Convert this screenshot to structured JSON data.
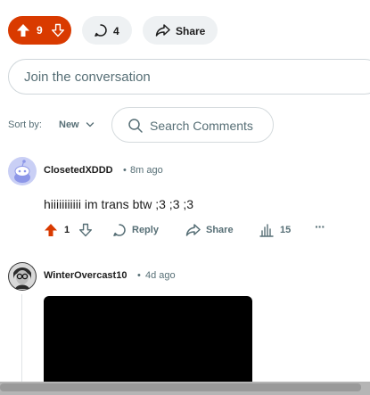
{
  "post_actions": {
    "vote_count": "9",
    "comment_count": "4",
    "share_label": "Share",
    "accent_color": "#d93a00"
  },
  "composer": {
    "placeholder": "Join the conversation"
  },
  "sort": {
    "label": "Sort by:",
    "value": "New"
  },
  "search": {
    "placeholder": "Search Comments"
  },
  "comments": [
    {
      "author": "ClosetedXDDD",
      "time": "8m ago",
      "body": "hiiiiiiiiiii im trans btw ;3 ;3 ;3",
      "votes": "1",
      "reply_label": "Reply",
      "share_label": "Share",
      "award_count": "15",
      "more_label": "···"
    },
    {
      "author": "WinterOvercast10",
      "time": "4d ago"
    }
  ],
  "separator": "•"
}
